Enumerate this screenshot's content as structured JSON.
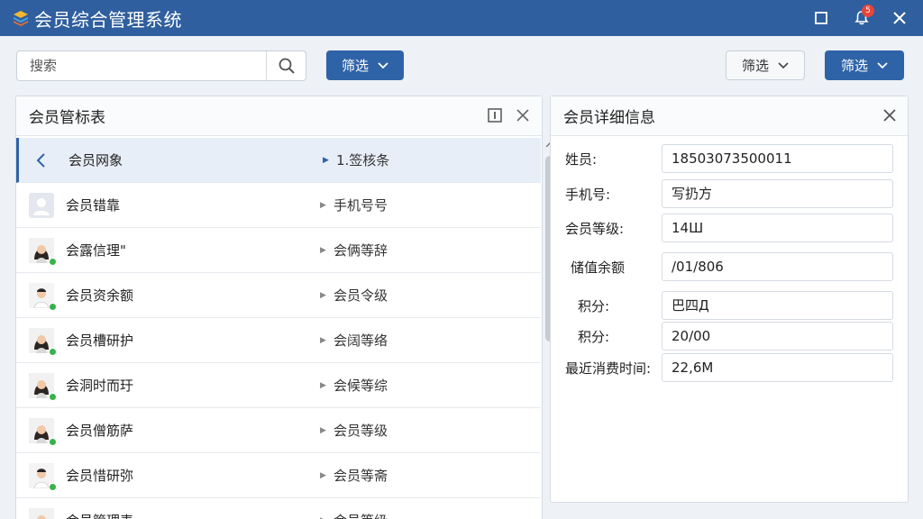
{
  "app": {
    "title": "会员综合管理系统",
    "notification_count": "5"
  },
  "toolbar": {
    "search_placeholder": "搜索",
    "filter1_label": "筛选",
    "filter2_label": "筛选",
    "filter3_label": "筛选"
  },
  "list_panel": {
    "title": "会员管标表",
    "rows": [
      {
        "name": "会员网象",
        "value": "1.签核条",
        "avatar": "back"
      },
      {
        "name": "会员错靠",
        "value": "手机号号",
        "avatar": "placeholder"
      },
      {
        "name": "会露信理\"",
        "value": "会俩等辞",
        "avatar": "female"
      },
      {
        "name": "会员资余额",
        "value": "会员令级",
        "avatar": "male"
      },
      {
        "name": "会员槽研护",
        "value": "会阔等络",
        "avatar": "female"
      },
      {
        "name": "会洞时而玗",
        "value": "会候等综",
        "avatar": "female"
      },
      {
        "name": "会员僧筋萨",
        "value": "会员等级",
        "avatar": "female"
      },
      {
        "name": "会员惜研弥",
        "value": "会员等斋",
        "avatar": "male"
      },
      {
        "name": "会员管理表",
        "value": "会员等级",
        "avatar": "female"
      }
    ]
  },
  "detail_panel": {
    "title": "会员详细信息",
    "fields": [
      {
        "label": "姓员:",
        "value": "18503073500011"
      },
      {
        "label": "手机号:",
        "value": "写扔方"
      },
      {
        "label": "会员等级:",
        "value": "14Ш"
      },
      {
        "label": "储值余额",
        "value": "/01/806"
      },
      {
        "label": "积分:",
        "value": "巴四Д"
      },
      {
        "label": "积分:",
        "value": "20/00"
      },
      {
        "label": "最近消费时间:",
        "value": "22,6M"
      }
    ]
  },
  "colors": {
    "titlebar": "#2f5f9e",
    "primary": "#2f63a8",
    "online": "#36b34a",
    "badge": "#e4463b"
  }
}
